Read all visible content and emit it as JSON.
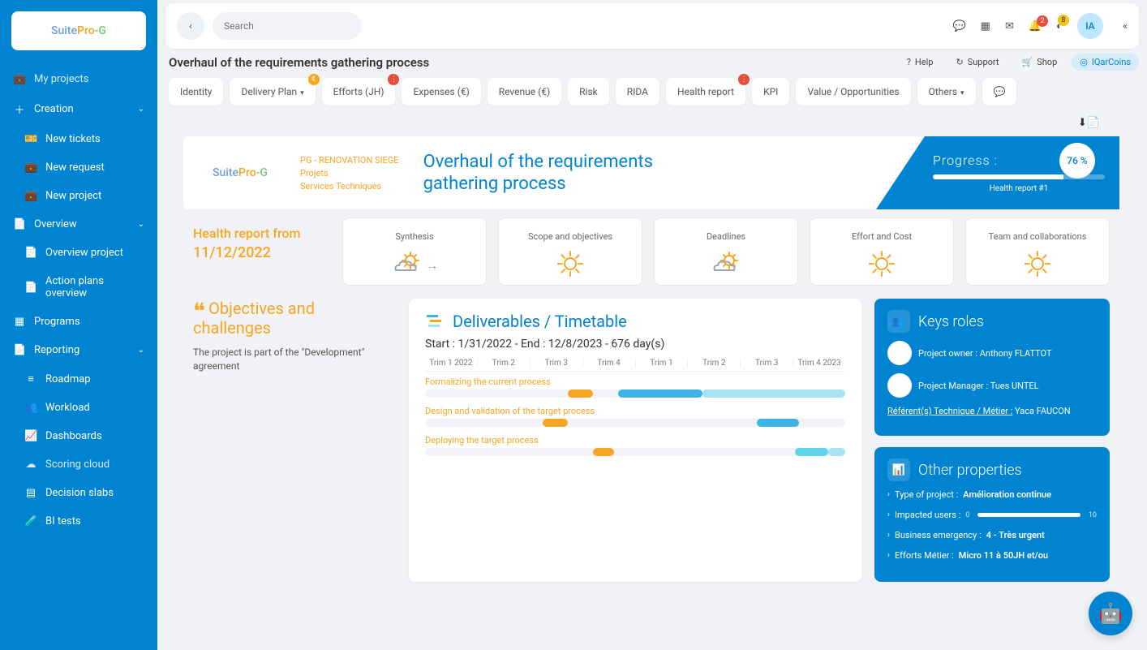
{
  "brand": "SuitePro-G",
  "search": {
    "placeholder": "Search"
  },
  "topbar": {
    "notif_count": "2",
    "pending_count": "8",
    "avatar_initials": "IA"
  },
  "sidebar": {
    "items": [
      {
        "icon": "briefcase",
        "label": "My projects",
        "child": false
      },
      {
        "icon": "plus",
        "label": "Creation",
        "child": false,
        "expandable": true
      },
      {
        "icon": "ticket",
        "label": "New tickets",
        "child": true
      },
      {
        "icon": "plus-briefcase",
        "label": "New request",
        "child": true
      },
      {
        "icon": "plus-briefcase",
        "label": "New project",
        "child": true
      },
      {
        "icon": "file",
        "label": "Overview",
        "child": false,
        "expandable": true
      },
      {
        "icon": "file",
        "label": "Overview project",
        "child": true
      },
      {
        "icon": "file",
        "label": "Action plans overview",
        "child": true
      },
      {
        "icon": "grid",
        "label": "Programs",
        "child": false
      },
      {
        "icon": "file",
        "label": "Reporting",
        "child": false,
        "expandable": true
      },
      {
        "icon": "bars",
        "label": "Roadmap",
        "child": true
      },
      {
        "icon": "users",
        "label": "Workload",
        "child": true
      },
      {
        "icon": "chart",
        "label": "Dashboards",
        "child": true
      },
      {
        "icon": "cloud",
        "label": "Scoring cloud",
        "child": true
      },
      {
        "icon": "table",
        "label": "Decision slabs",
        "child": true
      },
      {
        "icon": "flask",
        "label": "BI tests",
        "child": true
      }
    ]
  },
  "page": {
    "title": "Overhaul of the requirements gathering process"
  },
  "help_buttons": [
    {
      "icon": "?",
      "label": "Help"
    },
    {
      "icon": "↻",
      "label": "Support"
    },
    {
      "icon": "🛒",
      "label": "Shop"
    },
    {
      "icon": "◎",
      "label": "IQarCoins",
      "blue": true
    }
  ],
  "tabs": [
    {
      "label": "Identity"
    },
    {
      "label": "Delivery Plan",
      "caret": true,
      "dot": "orange",
      "dot_text": "€"
    },
    {
      "label": "Efforts (JH)",
      "dot": "red",
      "dot_text": "⋮"
    },
    {
      "label": "Expenses (€)"
    },
    {
      "label": "Revenue (€)"
    },
    {
      "label": "Risk"
    },
    {
      "label": "RIDA"
    },
    {
      "label": "Health report",
      "dot": "red",
      "dot_text": "⋮"
    },
    {
      "label": "KPI"
    },
    {
      "label": "Value / Opportunities"
    },
    {
      "label": "Others",
      "caret": true
    },
    {
      "label": "💬",
      "icon_only": true
    }
  ],
  "banner": {
    "meta1": "PG - RENOVATION SIEGE",
    "meta2": "Projets",
    "meta3": "Services Techniques",
    "title": "Overhaul of the requirements gathering process",
    "progress_label": "Progress    :",
    "progress_pct": "76 %",
    "progress_fill_pct": 76,
    "hr_caption": "Health report #1"
  },
  "health": {
    "from_label": "Health report from",
    "from_date": "11/12/2022",
    "cards": [
      {
        "label": "Synthesis",
        "weather": "partly",
        "arrow": true
      },
      {
        "label": "Scope and objectives",
        "weather": "sun"
      },
      {
        "label": "Deadlines",
        "weather": "partly"
      },
      {
        "label": "Effort and Cost",
        "weather": "sun"
      },
      {
        "label": "Team and collaborations",
        "weather": "sun"
      }
    ]
  },
  "objectives": {
    "title": "Objectives and challenges",
    "body": "The project is part of the \"Development\" agreement"
  },
  "deliverables": {
    "title": "Deliverables / Timetable",
    "range": "Start : 1/31/2022 - End : 12/8/2023 - 676 day(s)",
    "quarters": [
      "Trim 1 2022",
      "Trim 2",
      "Trim 3",
      "Trim 4",
      "Trim 1",
      "Trim 2",
      "Trim 3",
      "Trim 4 2023"
    ],
    "tasks": [
      {
        "name": "Formalizing the current process"
      },
      {
        "name": "Design and validation of the target process"
      },
      {
        "name": "Deploying the target process"
      }
    ]
  },
  "keys_roles": {
    "title": "Keys roles",
    "rows": [
      {
        "label": "Project owner :",
        "name": "Anthony FLATTOT"
      },
      {
        "label": "Project Manager :",
        "name": "Tues UNTEL"
      },
      {
        "label_link": "Référent(s) Technique / Métier :",
        "name": "Yaca FAUCON"
      }
    ]
  },
  "other_props": {
    "title": "Other properties",
    "rows": [
      {
        "label": "Type of project :",
        "value": "Amélioration continue"
      },
      {
        "label": "Impacted users :",
        "slider": true,
        "min": "0",
        "max": "10"
      },
      {
        "label": "Business emergency :",
        "value": "4 - Très urgent"
      },
      {
        "label": "Efforts Métier :",
        "value": "Micro 11 à 50JH et/ou"
      }
    ]
  }
}
